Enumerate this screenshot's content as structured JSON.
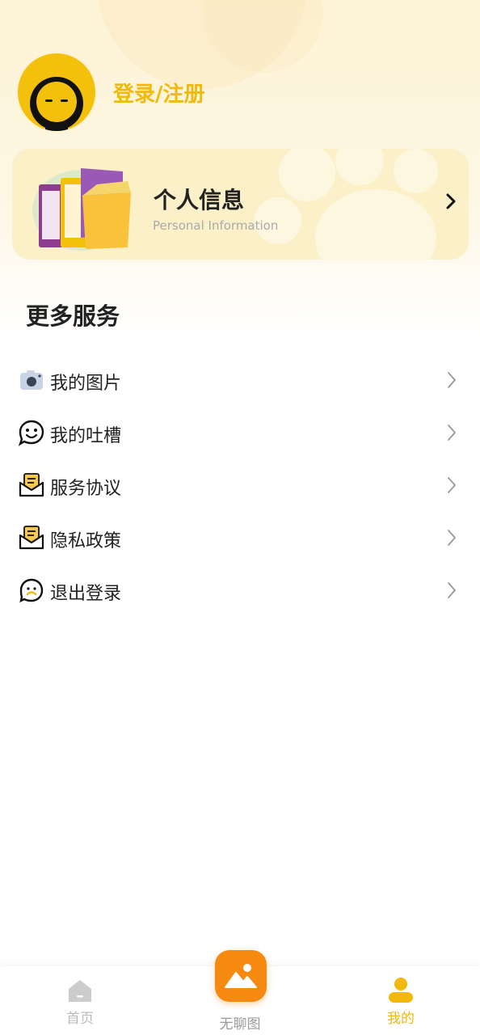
{
  "header": {
    "login_text": "登录/注册"
  },
  "info_card": {
    "title": "个人信息",
    "subtitle": "Personal Information"
  },
  "more_services": {
    "title": "更多服务",
    "items": [
      {
        "label": "我的图片",
        "icon": "camera-icon"
      },
      {
        "label": "我的吐槽",
        "icon": "chat-smile-icon"
      },
      {
        "label": "服务协议",
        "icon": "envelope-doc-icon"
      },
      {
        "label": "隐私政策",
        "icon": "envelope-doc-icon"
      },
      {
        "label": "退出登录",
        "icon": "logout-face-icon"
      }
    ]
  },
  "tabbar": {
    "home_label": "首页",
    "center_label": "无聊图",
    "mine_label": "我的",
    "active_color": "#f0b90b",
    "center_color": "#f6890f"
  }
}
